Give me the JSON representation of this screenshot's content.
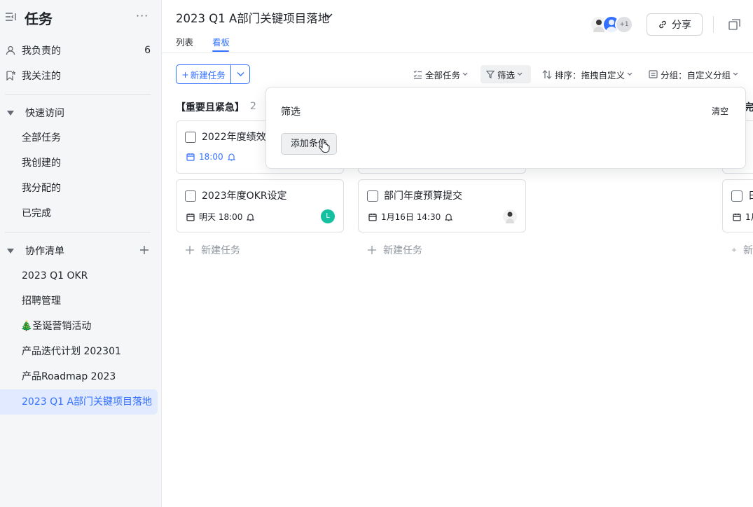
{
  "sidebar": {
    "title": "任务",
    "my_tasks": {
      "label": "我负责的",
      "count": "6"
    },
    "followed": {
      "label": "我关注的"
    },
    "quick_access": {
      "label": "快速访问",
      "items": [
        "全部任务",
        "我创建的",
        "我分配的",
        "已完成"
      ]
    },
    "collab": {
      "label": "协作清单",
      "items": [
        "2023 Q1 OKR",
        "招聘管理",
        "🎄圣诞营销活动",
        "产品迭代计划 202301",
        "产品Roadmap 2023",
        "2023 Q1 A部门关键项目落地"
      ]
    }
  },
  "header": {
    "title": "2023 Q1 A部门关键项目落地",
    "tabs": [
      "列表",
      "看板"
    ],
    "active_tab": "看板",
    "avatar_more": "+1",
    "share": "分享"
  },
  "toolbar": {
    "new_task": "新建任务",
    "all_tasks": "全部任务",
    "filter": "筛选",
    "sort": "排序：拖拽自定义",
    "group": "分组：自定义分组"
  },
  "columns": [
    {
      "title": "【重要且紧急】",
      "count": "2",
      "cards": [
        {
          "title": "2022年度绩效",
          "date": "18:00",
          "date_color": "#3370ff"
        },
        {
          "title": "2023年度OKR设定",
          "date": "明天 18:00",
          "assignee": "L",
          "assignee_color": "#14c0a0"
        }
      ],
      "add": "新建任务"
    },
    {
      "title": "",
      "cards": [
        {
          "title": "部门年度预算提交",
          "date": "1月16日 14:30"
        }
      ],
      "add": "新建任务"
    },
    {
      "title": "完",
      "cards": [
        {
          "title": "日",
          "date": "1月"
        }
      ],
      "add": "新"
    }
  ],
  "filter_popup": {
    "title": "筛选",
    "clear": "清空",
    "add_condition": "添加条件"
  },
  "colors": {
    "accent": "#3370ff",
    "sidebar_bg": "#f5f6f7",
    "active_bg": "#e1eaff"
  }
}
